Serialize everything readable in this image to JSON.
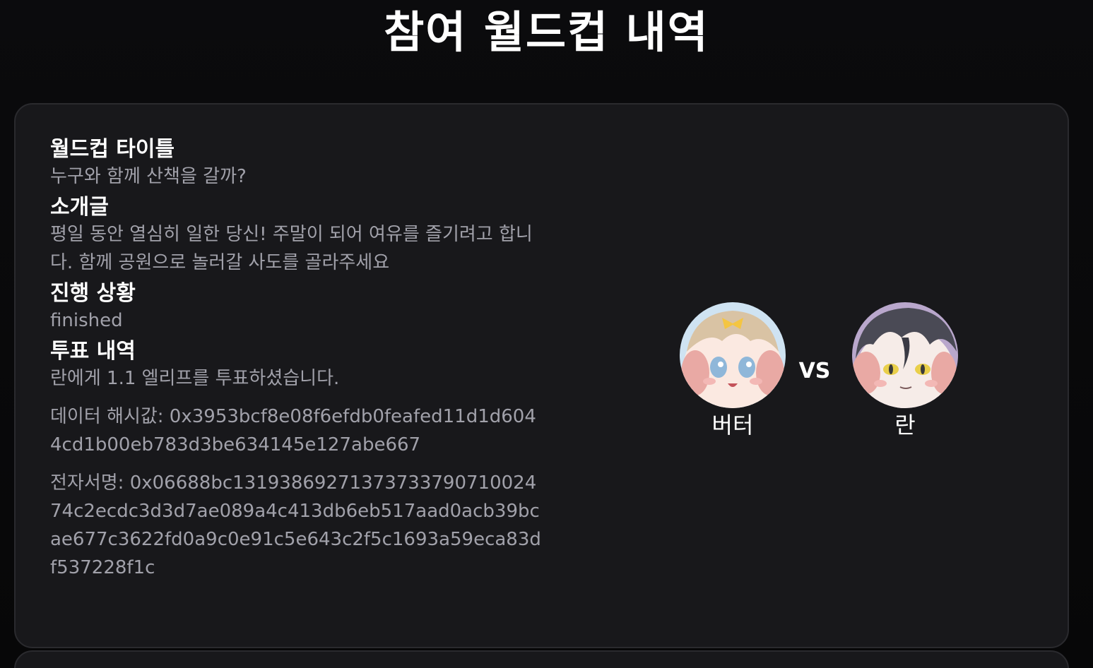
{
  "page": {
    "title": "참여 월드컵 내역"
  },
  "card": {
    "title_label": "월드컵 타이틀",
    "title_value": "누구와 함께 산책을 갈까?",
    "intro_label": "소개글",
    "intro_value": "평일 동안 열심히 일한 당신! 주말이 되어 여유를 즐기려고 합니다. 함께 공원으로 놀러갈 사도를 골라주세요",
    "status_label": "진행 상황",
    "status_value": "finished",
    "vote_label": "투표 내역",
    "vote_value": "란에게 1.1 엘리프를 투표하셨습니다.",
    "hash_text": "데이터 해시값: 0x3953bcf8e08f6efdb0feafed11d1d6044cd1b00eb783d3be634145e127abe667",
    "signature_text": "전자서명: 0x06688bc1319386927137373379071002474c2ecdc3d3d7ae089a4c413db6eb517aad0acb39bcae677c3622fd0a9c0e91c5e643c2f5c1693a59eca83df537228f1c"
  },
  "matchup": {
    "left_name": "버터",
    "right_name": "란",
    "vs_label": "VS"
  },
  "colors": {
    "background": "#09090b",
    "card": "#18181b",
    "label": "#ffffff",
    "muted": "#a1a1aa"
  }
}
